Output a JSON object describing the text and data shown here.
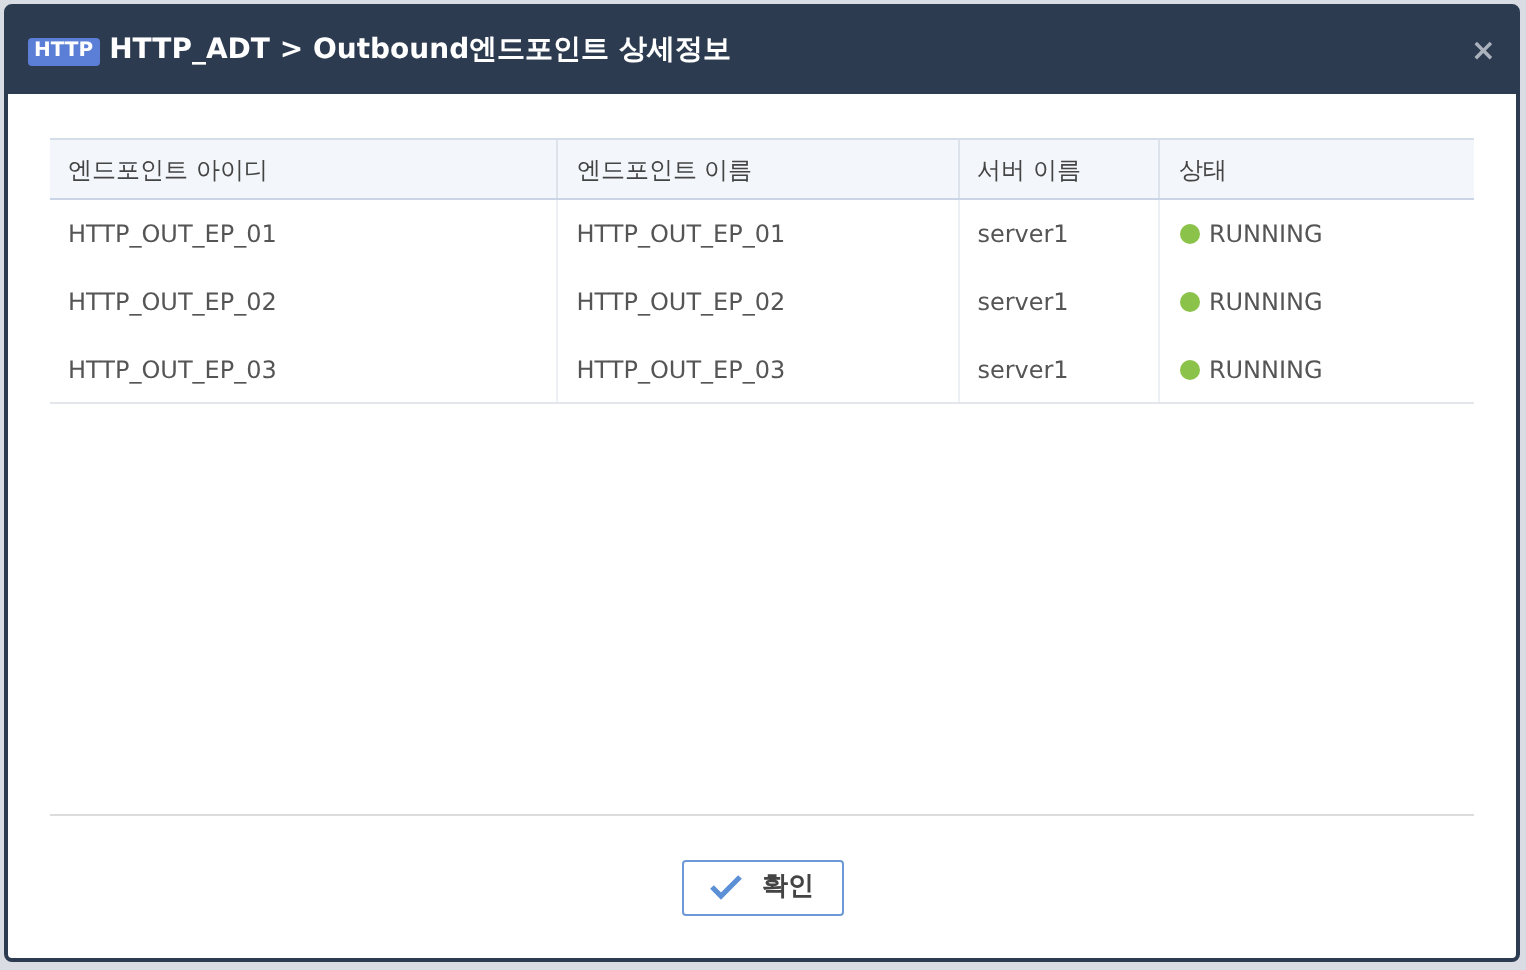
{
  "dialog": {
    "badge": "HTTP",
    "title": "HTTP_ADT > Outbound엔드포인트 상세정보",
    "close": "×"
  },
  "table": {
    "columns": [
      "엔드포인트 아이디",
      "엔드포인트 이름",
      "서버 이름",
      "상태"
    ],
    "rows": [
      {
        "id": "HTTP_OUT_EP_01",
        "name": "HTTP_OUT_EP_01",
        "server": "server1",
        "status": "RUNNING",
        "color": "#8bc34a"
      },
      {
        "id": "HTTP_OUT_EP_02",
        "name": "HTTP_OUT_EP_02",
        "server": "server1",
        "status": "RUNNING",
        "color": "#8bc34a"
      },
      {
        "id": "HTTP_OUT_EP_03",
        "name": "HTTP_OUT_EP_03",
        "server": "server1",
        "status": "RUNNING",
        "color": "#8bc34a"
      }
    ]
  },
  "buttons": [
    {
      "label": "확인"
    }
  ]
}
